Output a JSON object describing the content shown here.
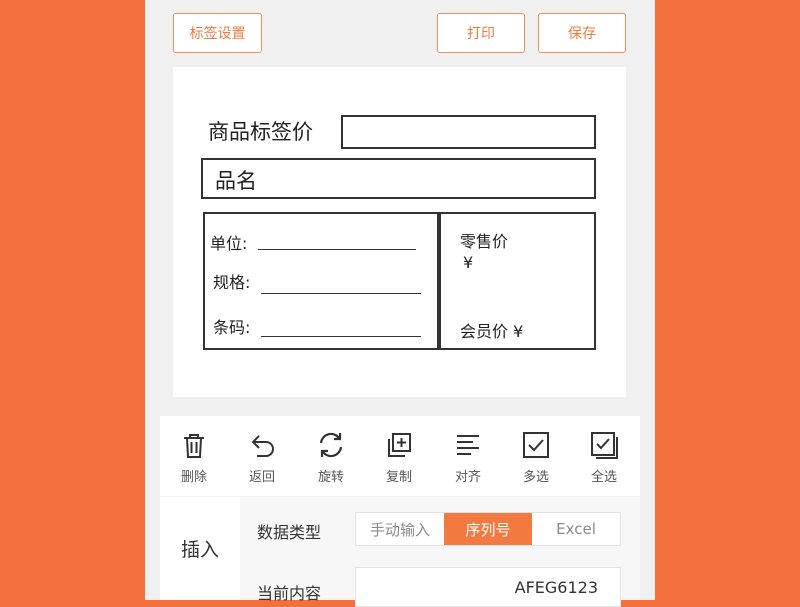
{
  "toolbar_top": {
    "label_settings": "标签设置",
    "print": "打印",
    "save": "保存"
  },
  "label": {
    "title": "商品标签价",
    "name": "品名",
    "unit": "单位:",
    "spec": "规格:",
    "barcode": "条码:",
    "retail_price": "零售价",
    "currency": "¥",
    "member_price": "会员价 ¥"
  },
  "tools": [
    {
      "label": "删除",
      "icon": "trash-icon"
    },
    {
      "label": "返回",
      "icon": "undo-icon"
    },
    {
      "label": "旋转",
      "icon": "rotate-icon"
    },
    {
      "label": "复制",
      "icon": "copy-icon"
    },
    {
      "label": "对齐",
      "icon": "align-icon"
    },
    {
      "label": "多选",
      "icon": "checkbox-icon"
    },
    {
      "label": "全选",
      "icon": "select-all-icon"
    }
  ],
  "panel": {
    "side_tab": "插入",
    "data_type_label": "数据类型",
    "data_type_options": [
      "手动输入",
      "序列号",
      "Excel"
    ],
    "data_type_selected": "序列号",
    "current_content_label": "当前内容",
    "current_content_value": "AFEG6123"
  },
  "colors": {
    "accent": "#f27a41",
    "background": "#f36f3c"
  }
}
